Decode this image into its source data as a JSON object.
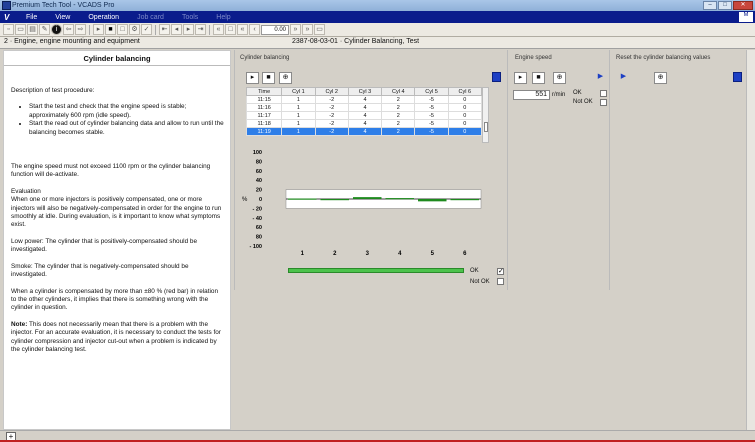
{
  "window": {
    "title": "Premium Tech Tool - VCADS Pro",
    "btn_min": "–",
    "btn_max": "□",
    "btn_close": "✕"
  },
  "menu": {
    "logo": "V",
    "items": [
      {
        "label": "File",
        "enabled": true
      },
      {
        "label": "View",
        "enabled": true
      },
      {
        "label": "Operation",
        "enabled": true
      },
      {
        "label": "Job card",
        "enabled": false
      },
      {
        "label": "Tools",
        "enabled": false
      },
      {
        "label": "Help",
        "enabled": false
      }
    ],
    "right_label": "M"
  },
  "toolbar": {
    "zoom_value": "0.00"
  },
  "breadcrumb": {
    "left": "2 · Engine, engine mounting and equipment",
    "right": "2387-08-03-01 · Cylinder Balancing, Test"
  },
  "left_panel": {
    "title": "Cylinder balancing",
    "intro": "Description of test procedure:",
    "bullets": [
      "Start the test and check that the engine speed is stable; approximately 600 rpm (idle speed).",
      "Start the read out of cylinder balancing data and allow to run until the balancing becomes stable."
    ],
    "p_speed": "The engine speed must not exceed 1100 rpm or the cylinder balancing function will de-activate.",
    "p_eval_head": "Evaluation",
    "p_eval": "When one or more injectors is positively compensated, one or more injectors will also be negatively-compensated in order for the engine to run smoothly at idle. During evaluation, is it important to know what symptoms exist.",
    "p_low": "Low power: The cylinder that is positively-compensated should be investigated.",
    "p_smoke": "Smoke: The cylinder that is negatively-compensated should be investigated.",
    "p_comp": "When a cylinder is compensated by more than ±80 % (red bar) in relation to the other cylinders, it implies that there is something wrong with the cylinder in question.",
    "p_note_bold": "Note:",
    "p_note": " This does not necessarily mean that there is a problem with the injector. For an accurate evaluation, it is necessary to conduct the tests for cylinder compression and injector cut-out when a problem is indicated by the cylinder balancing test."
  },
  "sections": {
    "cyl": "Cylinder balancing",
    "speed": "Engine speed",
    "reset": "Reset the cylinder balancing values"
  },
  "table": {
    "headers": [
      "Time",
      "Cyl 1",
      "Cyl 2",
      "Cyl 3",
      "Cyl 4",
      "Cyl 5",
      "Cyl 6"
    ],
    "rows": [
      [
        "11:15",
        "1",
        "-2",
        "4",
        "2",
        "-5",
        "0"
      ],
      [
        "11:16",
        "1",
        "-2",
        "4",
        "2",
        "-5",
        "0"
      ],
      [
        "11:17",
        "1",
        "-2",
        "4",
        "2",
        "-5",
        "0"
      ],
      [
        "11:18",
        "1",
        "-2",
        "4",
        "2",
        "-5",
        "0"
      ],
      [
        "11:19",
        "1",
        "-2",
        "4",
        "2",
        "-5",
        "0"
      ]
    ],
    "selected_row": 4
  },
  "chart_data": {
    "type": "bar",
    "categories": [
      "1",
      "2",
      "3",
      "4",
      "5",
      "6"
    ],
    "values": [
      1,
      -2,
      4,
      2,
      -5,
      0
    ],
    "ylabel": "%",
    "ylim": [
      -100,
      100
    ],
    "yticks": [
      "100",
      "80",
      "60",
      "40",
      "20",
      "0",
      "- 20",
      "- 40",
      "60",
      "80",
      "- 100"
    ],
    "bar_color": "#1e8a1e"
  },
  "speed": {
    "value": "551",
    "unit": "r/min",
    "ok": "OK",
    "not_ok": "Not OK"
  },
  "result": {
    "ok": "OK",
    "not_ok": "Not OK",
    "ok_checked": true
  }
}
